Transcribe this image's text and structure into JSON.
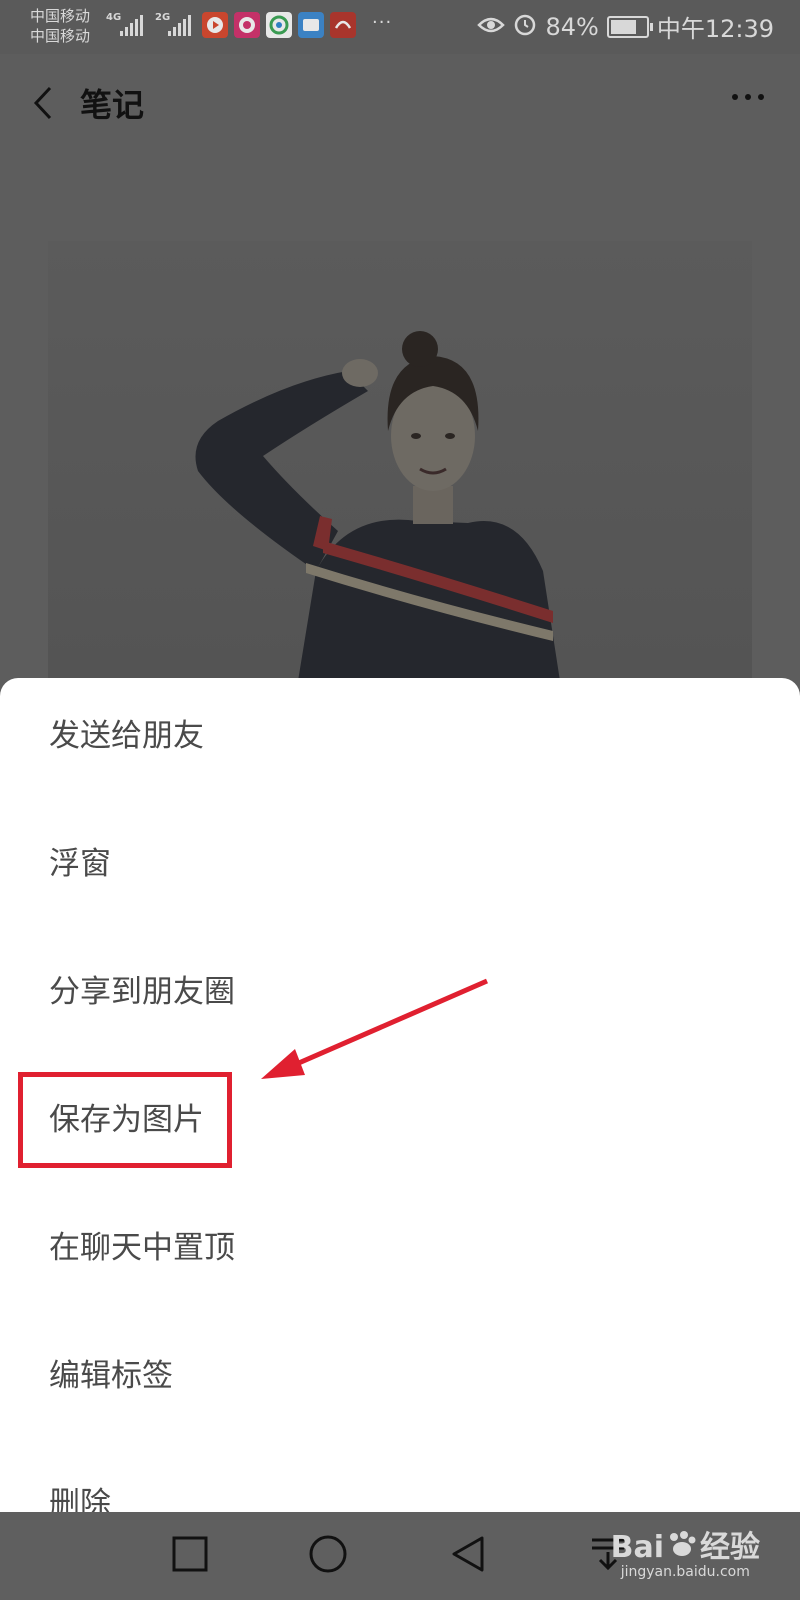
{
  "status_bar": {
    "carrier_1": "中国移动",
    "carrier_2": "中国移动",
    "net_1": "4G",
    "net_2": "2G",
    "overflow": "···",
    "battery_percent": "84%",
    "battery_level": 0.84,
    "time": "中午12:39",
    "icons": [
      "eye-comfort-icon",
      "alarm-icon",
      "battery-icon"
    ]
  },
  "header": {
    "title": "笔记"
  },
  "sheet": {
    "items": [
      "发送给朋友",
      "浮窗",
      "分享到朋友圈",
      "保存为图片",
      "在聊天中置顶",
      "编辑标签",
      "删除"
    ]
  },
  "annotation": {
    "color": "#e02030"
  },
  "watermark": {
    "brand": "Bai",
    "brand_suffix": "经验",
    "url": "jingyan.baidu.com"
  },
  "colors": {
    "overlay": "#5d5d5d",
    "sheet": "#ffffff",
    "text": "#4a4a4a",
    "highlight": "#e02030"
  }
}
